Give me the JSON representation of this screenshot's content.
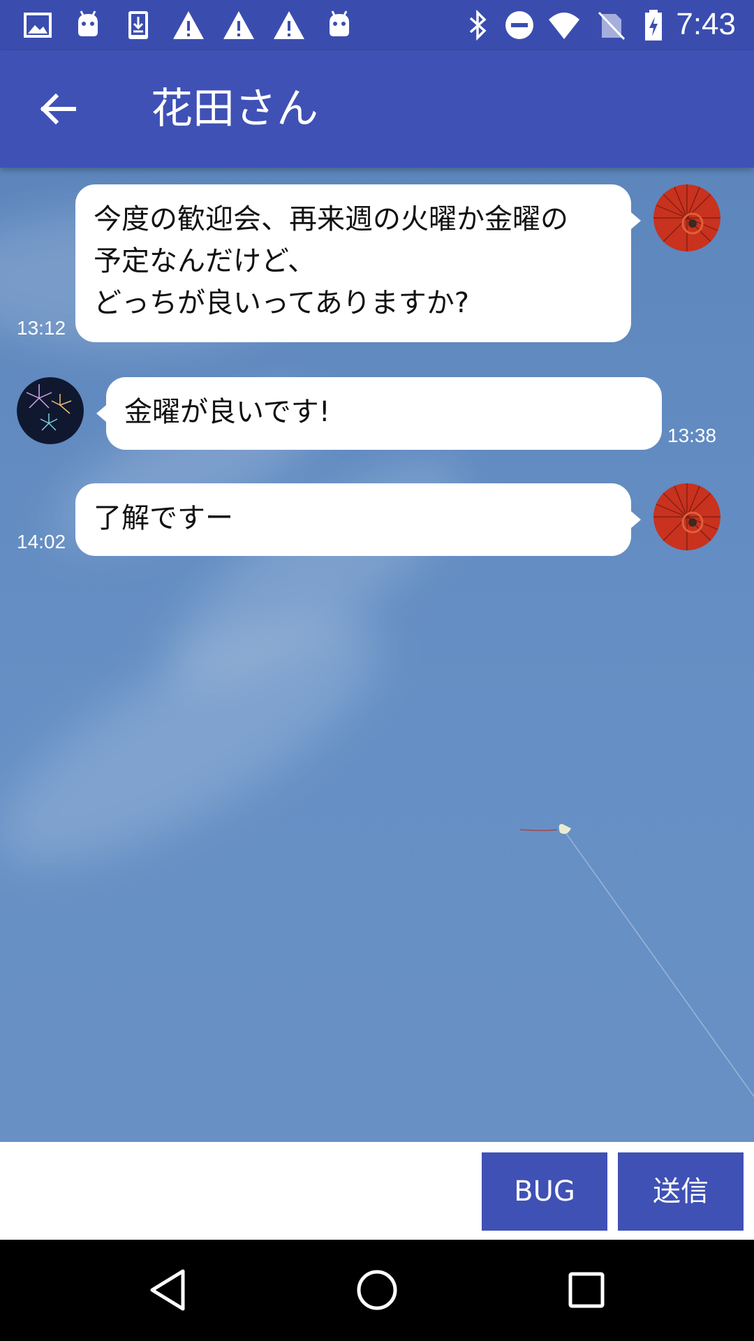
{
  "status_bar": {
    "time": "7:43",
    "left_icons": [
      "image-icon",
      "android-icon",
      "download-icon",
      "warning-icon",
      "warning-icon",
      "warning-icon",
      "android-icon"
    ],
    "right_icons": [
      "bluetooth-icon",
      "do-not-disturb-icon",
      "wifi-icon",
      "no-sim-icon",
      "battery-charging-icon"
    ]
  },
  "app_bar": {
    "title": "花田さん",
    "back_icon": "arrow-back-icon",
    "color": "#3F51B5"
  },
  "messages": [
    {
      "side": "right",
      "lines": [
        "今度の歓迎会、再来週の火曜か金曜の",
        "予定なんだけど、",
        "どっちが良いってありますか?"
      ],
      "time": "13:12",
      "avatar": "umbrella-avatar"
    },
    {
      "side": "left",
      "lines": [
        "金曜が良いです!"
      ],
      "time": "13:38",
      "avatar": "fireworks-avatar"
    },
    {
      "side": "right",
      "lines": [
        "了解ですー"
      ],
      "time": "14:02",
      "avatar": "umbrella-avatar"
    }
  ],
  "input": {
    "value": "",
    "placeholder": ""
  },
  "buttons": {
    "bug_label": "BUG",
    "send_label": "送信"
  },
  "nav": [
    "back-triangle-icon",
    "home-circle-icon",
    "recents-square-icon"
  ]
}
